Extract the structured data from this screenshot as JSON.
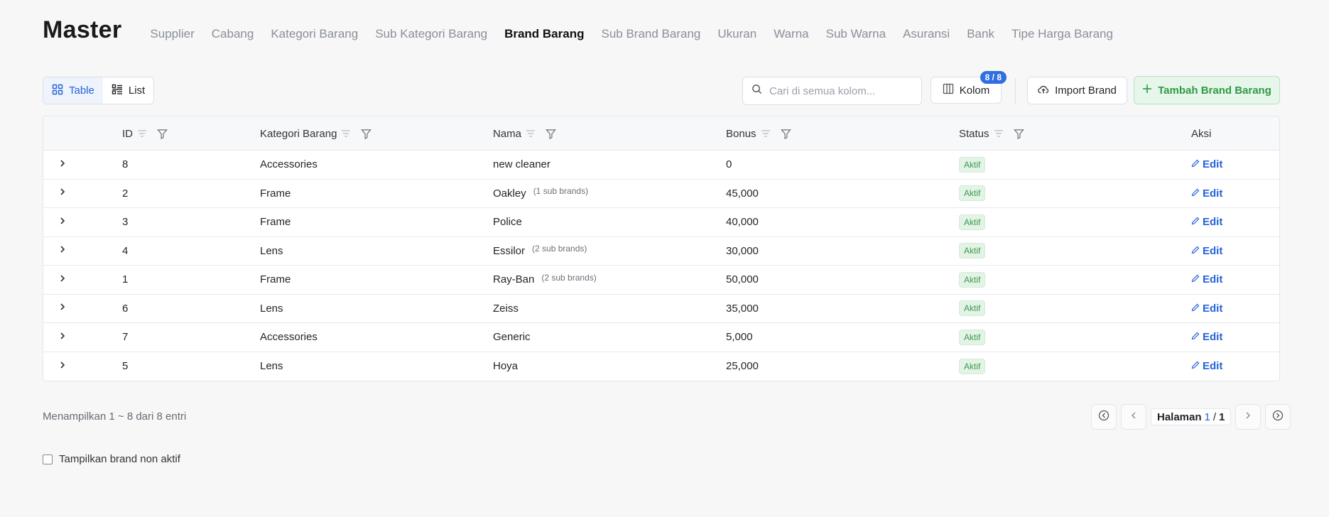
{
  "header": {
    "title": "Master",
    "nav": [
      "Supplier",
      "Cabang",
      "Kategori Barang",
      "Sub Kategori Barang",
      "Brand Barang",
      "Sub Brand Barang",
      "Ukuran",
      "Warna",
      "Sub Warna",
      "Asuransi",
      "Bank",
      "Tipe Harga Barang"
    ],
    "active_nav": "Brand Barang"
  },
  "toolbar": {
    "view_table_label": "Table",
    "view_list_label": "List",
    "search_placeholder": "Cari di semua kolom...",
    "columns_label": "Kolom",
    "columns_badge": "8 / 8",
    "import_label": "Import Brand",
    "add_label": "Tambah Brand Barang"
  },
  "table": {
    "columns": [
      "ID",
      "Kategori Barang",
      "Nama",
      "Bonus",
      "Status",
      "Aksi"
    ],
    "rows": [
      {
        "id": "8",
        "kategori": "Accessories",
        "nama": "new cleaner",
        "sub": "",
        "bonus": "0",
        "status": "Aktif",
        "action": "Edit"
      },
      {
        "id": "2",
        "kategori": "Frame",
        "nama": "Oakley",
        "sub": "(1 sub brands)",
        "bonus": "45,000",
        "status": "Aktif",
        "action": "Edit"
      },
      {
        "id": "3",
        "kategori": "Frame",
        "nama": "Police",
        "sub": "",
        "bonus": "40,000",
        "status": "Aktif",
        "action": "Edit"
      },
      {
        "id": "4",
        "kategori": "Lens",
        "nama": "Essilor",
        "sub": "(2 sub brands)",
        "bonus": "30,000",
        "status": "Aktif",
        "action": "Edit"
      },
      {
        "id": "1",
        "kategori": "Frame",
        "nama": "Ray-Ban",
        "sub": "(2 sub brands)",
        "bonus": "50,000",
        "status": "Aktif",
        "action": "Edit"
      },
      {
        "id": "6",
        "kategori": "Lens",
        "nama": "Zeiss",
        "sub": "",
        "bonus": "35,000",
        "status": "Aktif",
        "action": "Edit"
      },
      {
        "id": "7",
        "kategori": "Accessories",
        "nama": "Generic",
        "sub": "",
        "bonus": "5,000",
        "status": "Aktif",
        "action": "Edit"
      },
      {
        "id": "5",
        "kategori": "Lens",
        "nama": "Hoya",
        "sub": "",
        "bonus": "25,000",
        "status": "Aktif",
        "action": "Edit"
      }
    ]
  },
  "footer": {
    "summary": "Menampilkan 1 ~ 8 dari 8 entri",
    "page_label": "Halaman",
    "page_current": "1",
    "page_sep": "/",
    "page_total": "1",
    "show_inactive_label": "Tampilkan brand non aktif"
  },
  "colors": {
    "accent": "#2463d9",
    "success": "#2e9a44",
    "badge": "#2f6fe0"
  }
}
